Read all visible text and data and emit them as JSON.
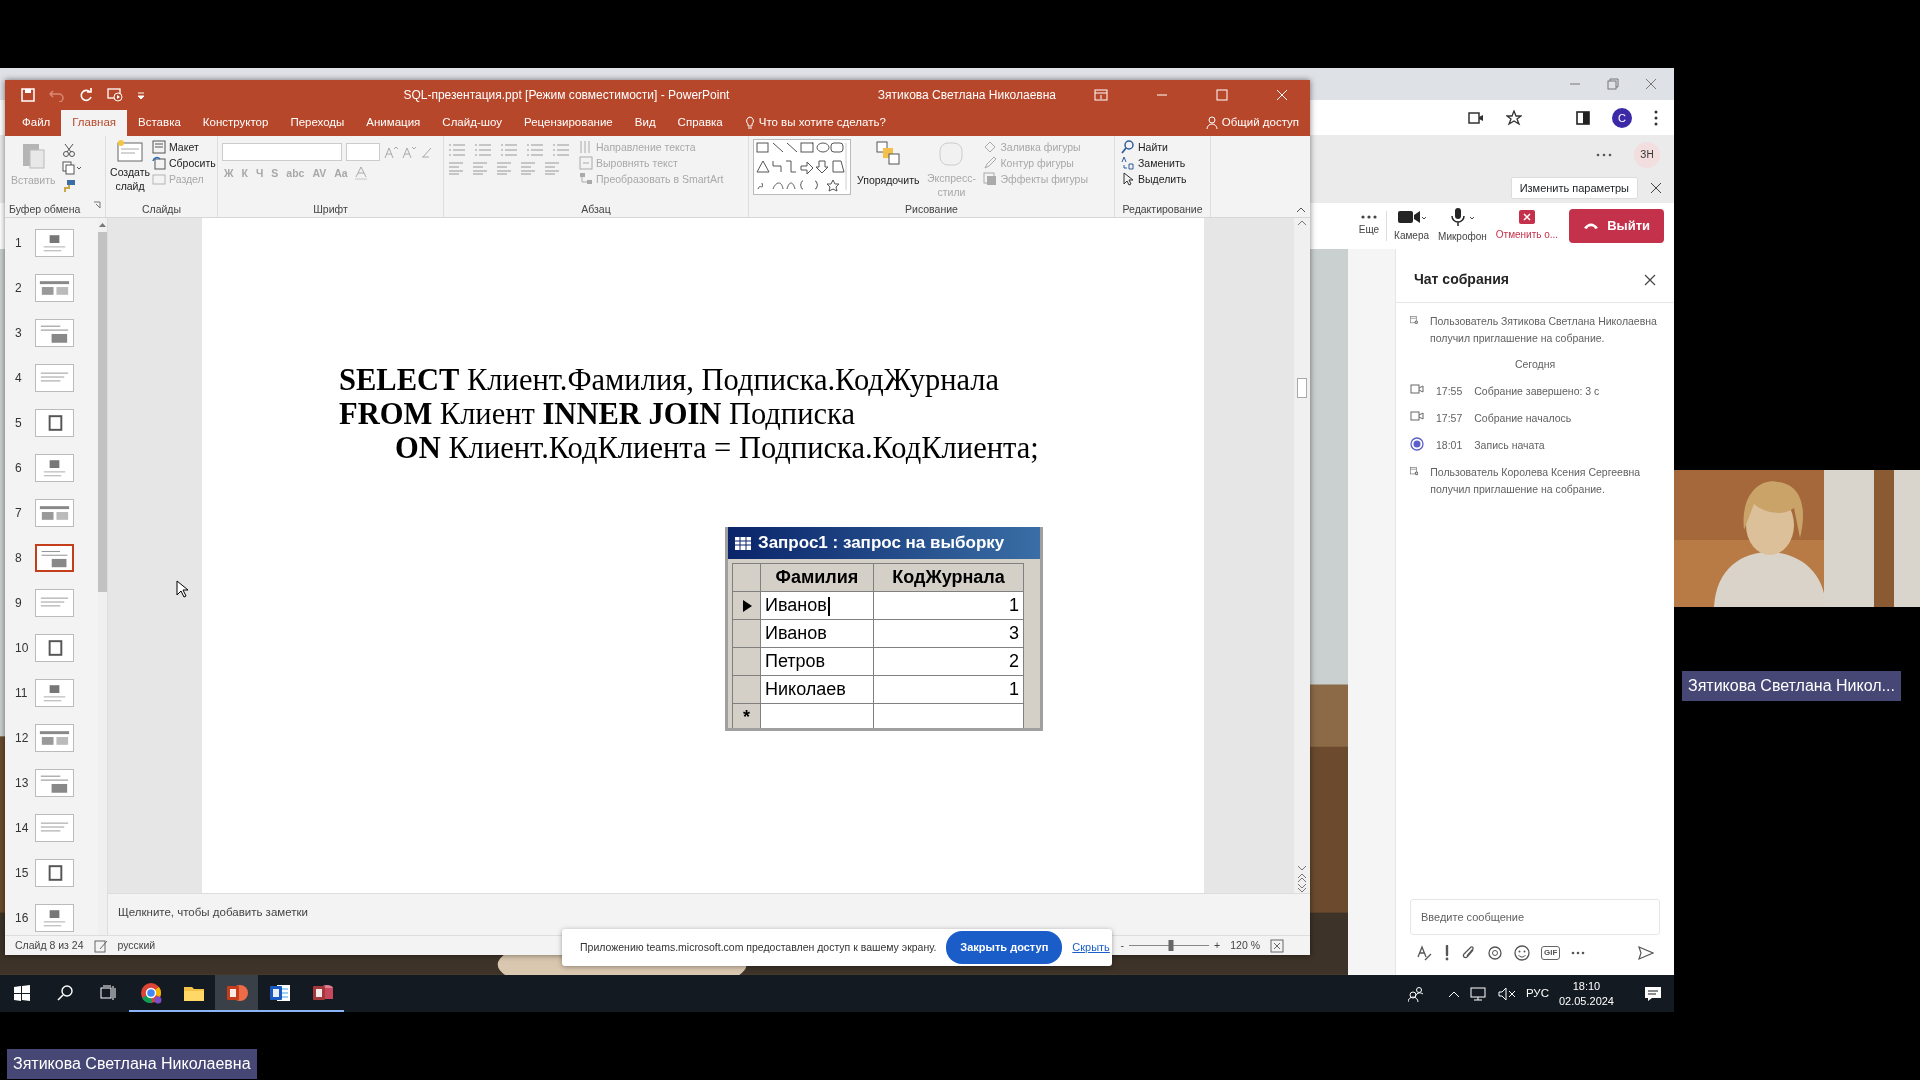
{
  "powerpoint": {
    "title": "SQL-презентация.ppt [Режим совместимости]  -  PowerPoint",
    "user": "Зятикова Светлана Николаевна",
    "tabs": [
      {
        "label": "Файл",
        "selected": false
      },
      {
        "label": "Главная",
        "selected": true
      },
      {
        "label": "Вставка",
        "selected": false
      },
      {
        "label": "Конструктор",
        "selected": false
      },
      {
        "label": "Переходы",
        "selected": false
      },
      {
        "label": "Анимация",
        "selected": false
      },
      {
        "label": "Слайд-шоу",
        "selected": false
      },
      {
        "label": "Рецензирование",
        "selected": false
      },
      {
        "label": "Вид",
        "selected": false
      },
      {
        "label": "Справка",
        "selected": false
      }
    ],
    "tell_me": "Что вы хотите сделать?",
    "share": "Общий доступ",
    "ribbon": {
      "clipboard": {
        "label": "Буфер обмена",
        "paste": {
          "label": "Вставить",
          "disabled": true
        }
      },
      "slides": {
        "label": "Слайды",
        "new_slide": {
          "label": "Создать слайд",
          "disabled": false
        },
        "layout": {
          "label": "Макет",
          "disabled": false
        },
        "reset": {
          "label": "Сбросить",
          "disabled": false
        },
        "section": {
          "label": "Раздел",
          "disabled": true
        }
      },
      "font": {
        "label": "Шрифт",
        "buttons": [
          {
            "label": "Ж",
            "disabled": true
          },
          {
            "label": "К",
            "disabled": true
          },
          {
            "label": "Ч",
            "disabled": true
          },
          {
            "label": "S",
            "disabled": true
          },
          {
            "label": "abc",
            "disabled": true
          },
          {
            "label": "AV",
            "disabled": true
          },
          {
            "label": "Aa",
            "disabled": true
          }
        ]
      },
      "paragraph": {
        "label": "Абзац",
        "text_direction": {
          "label": "Направление текста",
          "disabled": true
        },
        "align_text": {
          "label": "Выровнять текст",
          "disabled": true
        },
        "smartart": {
          "label": "Преобразовать в SmartArt",
          "disabled": true
        }
      },
      "drawing": {
        "label": "Рисование",
        "arrange": {
          "label": "Упорядочить",
          "disabled": false
        },
        "quick_styles": {
          "label": "Экспресс-стили",
          "disabled": true
        },
        "fill": {
          "label": "Заливка фигуры",
          "disabled": true
        },
        "outline": {
          "label": "Контур фигуры",
          "disabled": true
        },
        "effects": {
          "label": "Эффекты фигуры",
          "disabled": true
        }
      },
      "editing": {
        "label": "Редактирование",
        "find": {
          "label": "Найти",
          "disabled": false
        },
        "replace": {
          "label": "Заменить",
          "disabled": false
        },
        "select": {
          "label": "Выделить",
          "disabled": false
        }
      }
    },
    "thumbnails": [
      {
        "number": "1",
        "selected": false
      },
      {
        "number": "2",
        "selected": false
      },
      {
        "number": "3",
        "selected": false
      },
      {
        "number": "4",
        "selected": false
      },
      {
        "number": "5",
        "selected": false
      },
      {
        "number": "6",
        "selected": false
      },
      {
        "number": "7",
        "selected": false
      },
      {
        "number": "8",
        "selected": true
      },
      {
        "number": "9",
        "selected": false
      },
      {
        "number": "10",
        "selected": false
      },
      {
        "number": "11",
        "selected": false
      },
      {
        "number": "12",
        "selected": false
      },
      {
        "number": "13",
        "selected": false
      },
      {
        "number": "14",
        "selected": false
      },
      {
        "number": "15",
        "selected": false
      },
      {
        "number": "16",
        "selected": false
      }
    ],
    "slide": {
      "sql_lines": [
        {
          "text": "**SELECT** Клиент.Фамилия, Подписка.КодЖурнала",
          "indented": false
        },
        {
          "text": "**FROM** Клиент **INNER JOIN** Подписка",
          "indented": false
        },
        {
          "text": "**ON** Клиент.КодКлиента = Подписка.КодКлиента;",
          "indented": true
        }
      ],
      "query": {
        "title": "Запрос1 : запрос на выборку",
        "columns": [
          "Фамилия",
          "КодЖурнала"
        ],
        "rows": [
          {
            "cells": [
              "Иванов",
              "1"
            ],
            "current": true
          },
          {
            "cells": [
              "Иванов",
              "3"
            ],
            "current": false
          },
          {
            "cells": [
              "Петров",
              "2"
            ],
            "current": false
          },
          {
            "cells": [
              "Николаев",
              "1"
            ],
            "current": false
          }
        ],
        "new_row_marker": "*"
      }
    },
    "notes_placeholder": "Щелкните, чтобы добавить заметки",
    "status": {
      "slide": "Слайд 8 из 24",
      "language": "русский",
      "zoom_minus": "-",
      "zoom_plus": "+",
      "zoom": {
        "level": 0.53
      },
      "zoom_value": "120 %"
    }
  },
  "browser": {
    "avatar": "C",
    "teams": {
      "avatar": "ЗН",
      "banner_button": "Изменить параметры",
      "controls": [
        {
          "label": "Еще",
          "kind": "more"
        },
        {
          "label": "Камера",
          "kind": "camera"
        },
        {
          "label": "Микрофон",
          "kind": "mic"
        },
        {
          "label": "Отменить о...",
          "kind": "stop"
        }
      ],
      "leave": "Выйти",
      "chat": {
        "title": "Чат собрания",
        "messages": [
          {
            "kind": "invite",
            "text": "Пользователь Зятикова Светлана Николаевна получил приглашение на собрание."
          },
          {
            "kind": "date",
            "text": "Сегодня"
          },
          {
            "kind": "meeting",
            "time": "17:55",
            "text": "Собрание завершено: 3 с"
          },
          {
            "kind": "meeting",
            "time": "17:57",
            "text": "Собрание началось"
          },
          {
            "kind": "recording",
            "time": "18:01",
            "text": "Запись начата"
          },
          {
            "kind": "invite",
            "text": "Пользователь Королева Ксения Сергеевна получил приглашение на собрание."
          }
        ],
        "placeholder": "Введите сообщение",
        "gif": "GIF"
      }
    }
  },
  "share_bar": {
    "message": "Приложению teams.microsoft.com предоставлен доступ к вашему экрану.",
    "stop_button": "Закрыть доступ",
    "hide_link": "Скрыть"
  },
  "video_tile": {
    "name": "Зятикова Светлана Никол..."
  },
  "presenter_label": "Зятикова Светлана Николаевна",
  "taskbar": {
    "apps": [
      {
        "kind": "chrome",
        "active": false
      },
      {
        "kind": "explorer",
        "active": false
      },
      {
        "kind": "powerpoint",
        "active": true
      },
      {
        "kind": "word",
        "active": false
      },
      {
        "kind": "access",
        "active": false
      }
    ],
    "language": "РУС",
    "time": "18:10",
    "date": "02.05.2024"
  }
}
